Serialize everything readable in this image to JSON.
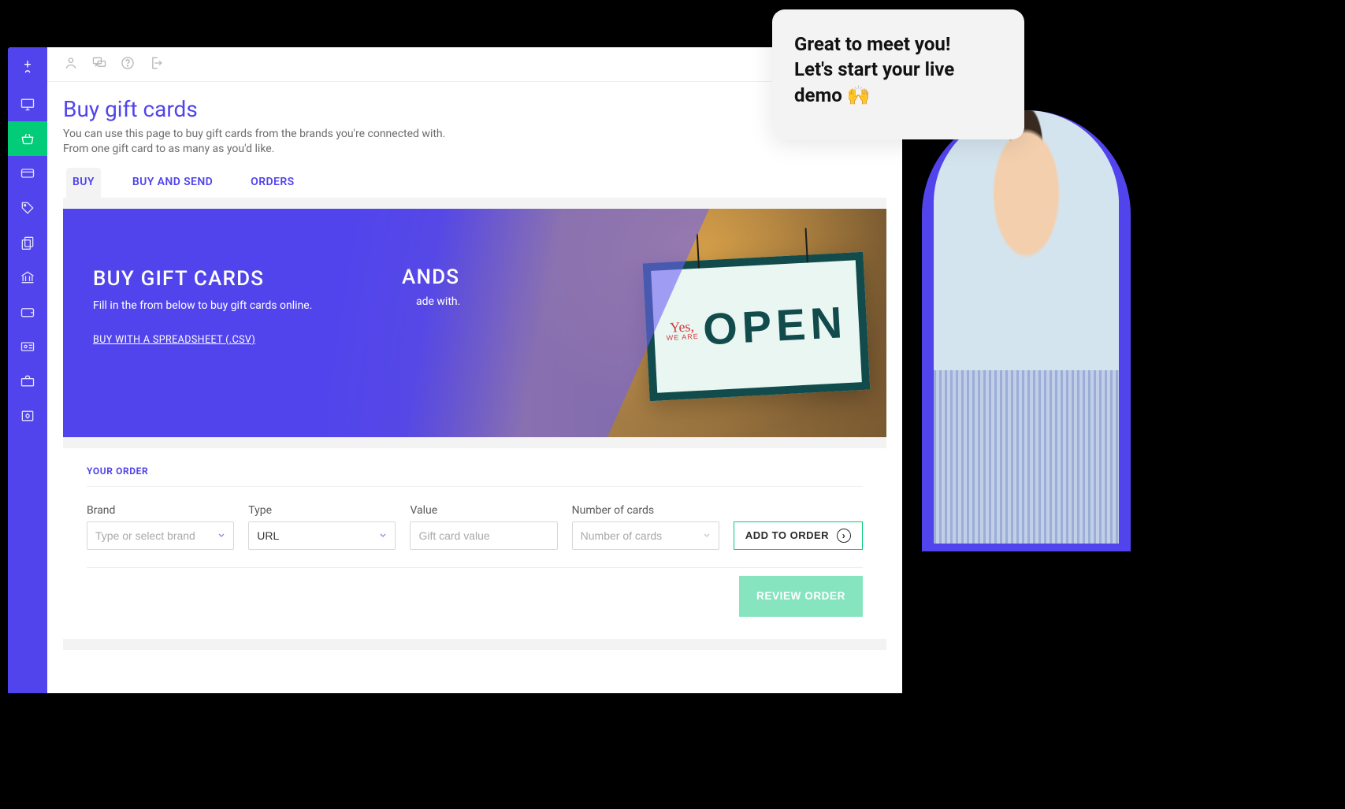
{
  "header": {
    "title": "Buy gift cards",
    "description": "You can use this page to buy gift cards from the brands you're connected with. From one gift card to as many as you'd like."
  },
  "tabs": [
    {
      "id": "buy",
      "label": "BUY",
      "active": true
    },
    {
      "id": "buy_and_send",
      "label": "BUY AND SEND",
      "active": false
    },
    {
      "id": "orders",
      "label": "ORDERS",
      "active": false
    }
  ],
  "banner": {
    "title": "BUY GIFT CARDS",
    "subtitle": "Fill in the from below to buy gift cards online.",
    "csv_link": "BUY WITH A SPREADSHEET (.CSV)",
    "ghost_title_fragment": "ANDS",
    "ghost_sub_fragment": "ade with.",
    "sign_small_top": "Yes,",
    "sign_small_bottom": "WE ARE",
    "sign_big": "OPEN"
  },
  "order": {
    "section_label": "YOUR ORDER",
    "fields": {
      "brand": {
        "label": "Brand",
        "placeholder": "Type or select brand"
      },
      "type": {
        "label": "Type",
        "value": "URL"
      },
      "value": {
        "label": "Value",
        "placeholder": "Gift card value"
      },
      "count": {
        "label": "Number of cards",
        "placeholder": "Number of cards"
      }
    },
    "add_button": "ADD TO ORDER",
    "review_button": "REVIEW ORDER"
  },
  "demo": {
    "bubble_line1": "Great to meet you!",
    "bubble_line2": "Let's start your live",
    "bubble_line3": "demo 🙌"
  }
}
